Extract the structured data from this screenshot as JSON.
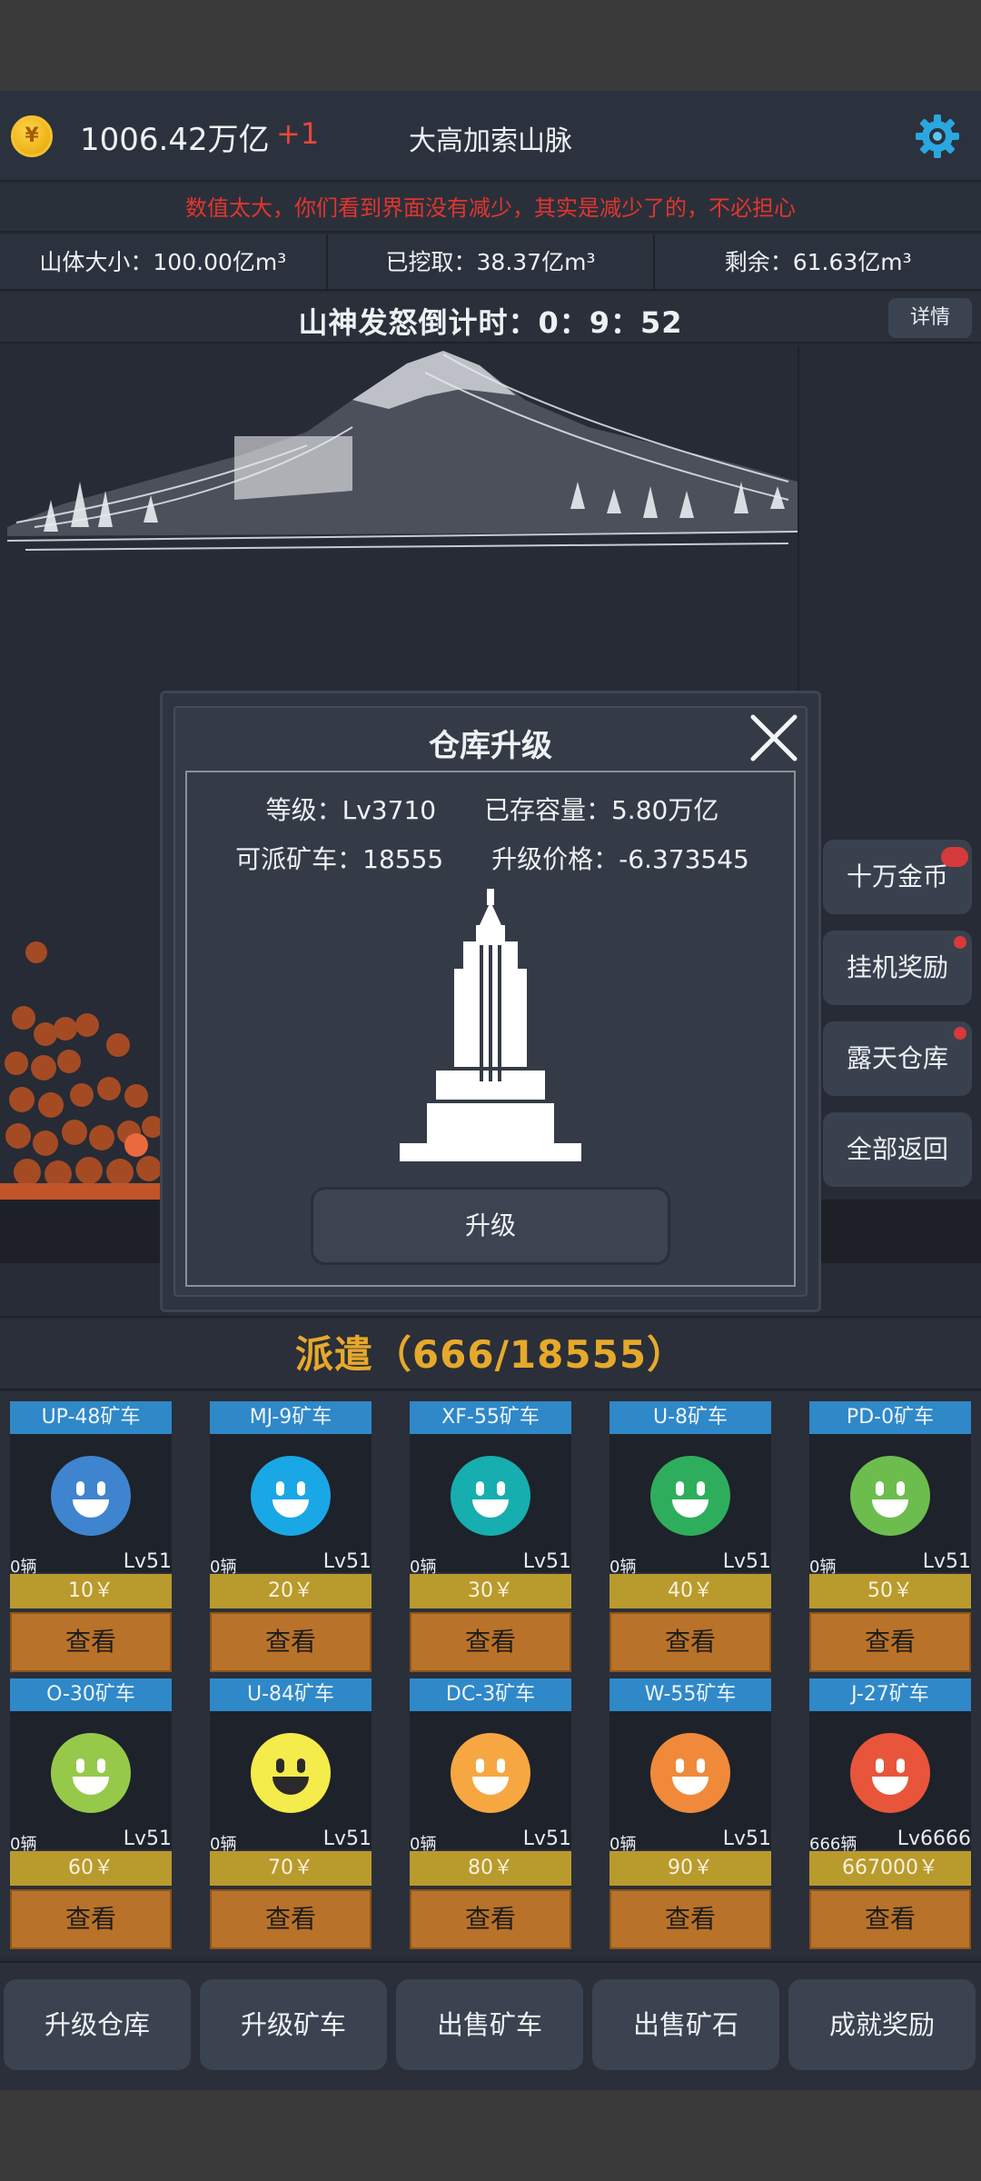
{
  "header": {
    "money": "1006.42万亿",
    "increment": "+1",
    "mountain_name": "大高加索山脉",
    "coin_symbol": "¥"
  },
  "notice": "数值太大，你们看到界面没有减少，其实是减少了的，不必担心",
  "stats": {
    "size": "山体大小：100.00亿m³",
    "mined": "已挖取：38.37亿m³",
    "remaining": "剩余：61.63亿m³"
  },
  "countdown": {
    "text": "山神发怒倒计时：0：9：52",
    "detail_label": "详情"
  },
  "side_buttons": [
    "十万金币",
    "挂机奖励",
    "露天仓库",
    "全部返回"
  ],
  "modal": {
    "title": "仓库升级",
    "level": "等级：Lv3710",
    "stored": "已存容量：5.80万亿",
    "dispatchable": "可派矿车：18555",
    "price": "升级价格：-6.373545",
    "upgrade_label": "升级"
  },
  "dispatch": {
    "title": "派遣（666/18555）"
  },
  "cars": [
    {
      "name": "UP-48矿车",
      "count": "0辆",
      "level": "Lv51",
      "price": "10￥",
      "view": "查看",
      "color": "#3f84cf"
    },
    {
      "name": "MJ-9矿车",
      "count": "0辆",
      "level": "Lv51",
      "price": "20￥",
      "view": "查看",
      "color": "#1aa7e6"
    },
    {
      "name": "XF-55矿车",
      "count": "0辆",
      "level": "Lv51",
      "price": "30￥",
      "view": "查看",
      "color": "#16aeae"
    },
    {
      "name": "U-8矿车",
      "count": "0辆",
      "level": "Lv51",
      "price": "40￥",
      "view": "查看",
      "color": "#2eae5c"
    },
    {
      "name": "PD-0矿车",
      "count": "0辆",
      "level": "Lv51",
      "price": "50￥",
      "view": "查看",
      "color": "#6cbd4e"
    },
    {
      "name": "O-30矿车",
      "count": "0辆",
      "level": "Lv51",
      "price": "60￥",
      "view": "查看",
      "color": "#96c94a"
    },
    {
      "name": "U-84矿车",
      "count": "0辆",
      "level": "Lv51",
      "price": "70￥",
      "view": "查看",
      "color": "#f4ec4a"
    },
    {
      "name": "DC-3矿车",
      "count": "0辆",
      "level": "Lv51",
      "price": "80￥",
      "view": "查看",
      "color": "#f6a742"
    },
    {
      "name": "W-55矿车",
      "count": "0辆",
      "level": "Lv51",
      "price": "90￥",
      "view": "查看",
      "color": "#f08a3a"
    },
    {
      "name": "J-27矿车",
      "count": "666辆",
      "level": "Lv6666",
      "price": "667000￥",
      "view": "查看",
      "color": "#e8553a"
    }
  ],
  "bottom_nav": [
    "升级仓库",
    "升级矿车",
    "出售矿车",
    "出售矿石",
    "成就奖励"
  ],
  "colors": {
    "accent_gold": "#e7a92b",
    "notice_red": "#e2352e",
    "card_blue": "#2f88c8",
    "price_gold": "#b99a2d",
    "view_orange": "#b97229"
  }
}
